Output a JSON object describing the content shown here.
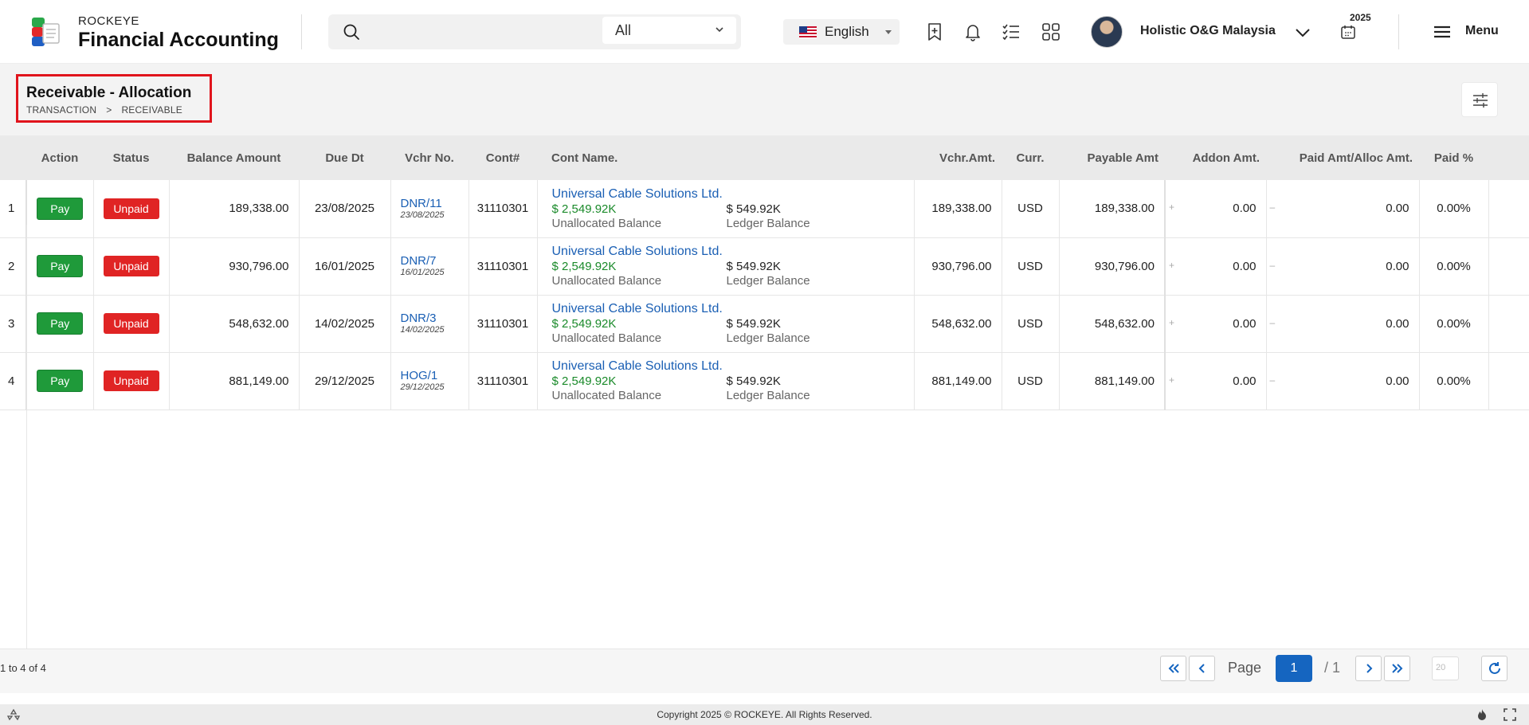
{
  "header": {
    "brand_small": "ROCKEYE",
    "brand_big": "Financial Accounting",
    "search_placeholder": "",
    "search_scope": "All",
    "language": "English",
    "company": "Holistic O&G Malaysia",
    "year": "2025",
    "menu_label": "Menu"
  },
  "page": {
    "title": "Receivable - Allocation",
    "breadcrumb": [
      "TRANSACTION",
      ">",
      "RECEIVABLE"
    ]
  },
  "table": {
    "columns": [
      "Action",
      "Status",
      "Balance Amount",
      "Due Dt",
      "Vchr No.",
      "Cont#",
      "Cont Name.",
      "Vchr.Amt.",
      "Curr.",
      "Payable Amt",
      "Addon Amt.",
      "Paid Amt/Alloc Amt.",
      "Paid %"
    ],
    "rows": [
      {
        "num": "1",
        "action": "Pay",
        "status": "Unpaid",
        "balance": "189,338.00",
        "due": "23/08/2025",
        "vchr_no": "DNR/11",
        "vchr_dt": "23/08/2025",
        "cont": "31110301",
        "cont_name": "Universal Cable Solutions Ltd.",
        "unalloc_amt": "$ 2,549.92K",
        "unalloc_label": "Unallocated Balance",
        "ledger_amt": "$ 549.92K",
        "ledger_label": "Ledger Balance",
        "vchr_amt": "189,338.00",
        "curr": "USD",
        "payable": "189,338.00",
        "addon": "0.00",
        "paid_alloc": "0.00",
        "paid_pct": "0.00%"
      },
      {
        "num": "2",
        "action": "Pay",
        "status": "Unpaid",
        "balance": "930,796.00",
        "due": "16/01/2025",
        "vchr_no": "DNR/7",
        "vchr_dt": "16/01/2025",
        "cont": "31110301",
        "cont_name": "Universal Cable Solutions Ltd.",
        "unalloc_amt": "$ 2,549.92K",
        "unalloc_label": "Unallocated Balance",
        "ledger_amt": "$ 549.92K",
        "ledger_label": "Ledger Balance",
        "vchr_amt": "930,796.00",
        "curr": "USD",
        "payable": "930,796.00",
        "addon": "0.00",
        "paid_alloc": "0.00",
        "paid_pct": "0.00%"
      },
      {
        "num": "3",
        "action": "Pay",
        "status": "Unpaid",
        "balance": "548,632.00",
        "due": "14/02/2025",
        "vchr_no": "DNR/3",
        "vchr_dt": "14/02/2025",
        "cont": "31110301",
        "cont_name": "Universal Cable Solutions Ltd.",
        "unalloc_amt": "$ 2,549.92K",
        "unalloc_label": "Unallocated Balance",
        "ledger_amt": "$ 549.92K",
        "ledger_label": "Ledger Balance",
        "vchr_amt": "548,632.00",
        "curr": "USD",
        "payable": "548,632.00",
        "addon": "0.00",
        "paid_alloc": "0.00",
        "paid_pct": "0.00%"
      },
      {
        "num": "4",
        "action": "Pay",
        "status": "Unpaid",
        "balance": "881,149.00",
        "due": "29/12/2025",
        "vchr_no": "HOG/1",
        "vchr_dt": "29/12/2025",
        "cont": "31110301",
        "cont_name": "Universal Cable Solutions Ltd.",
        "unalloc_amt": "$ 2,549.92K",
        "unalloc_label": "Unallocated Balance",
        "ledger_amt": "$ 549.92K",
        "ledger_label": "Ledger Balance",
        "vchr_amt": "881,149.00",
        "curr": "USD",
        "payable": "881,149.00",
        "addon": "0.00",
        "paid_alloc": "0.00",
        "paid_pct": "0.00%"
      }
    ],
    "addon_sign": "+",
    "paid_sign": "–"
  },
  "pager": {
    "range_text": "1 to 4 of 4",
    "page_label": "Page",
    "current_page": "1",
    "total_pages": "/ 1",
    "page_size": "20"
  },
  "footer": {
    "copyright": "Copyright 2025 © ROCKEYE. All Rights Reserved."
  },
  "colors": {
    "pay": "#1f9a3a",
    "unpaid": "#e02424",
    "link": "#1a5fb4",
    "highlight_border": "#e0141c",
    "page_active": "#1565c0"
  }
}
